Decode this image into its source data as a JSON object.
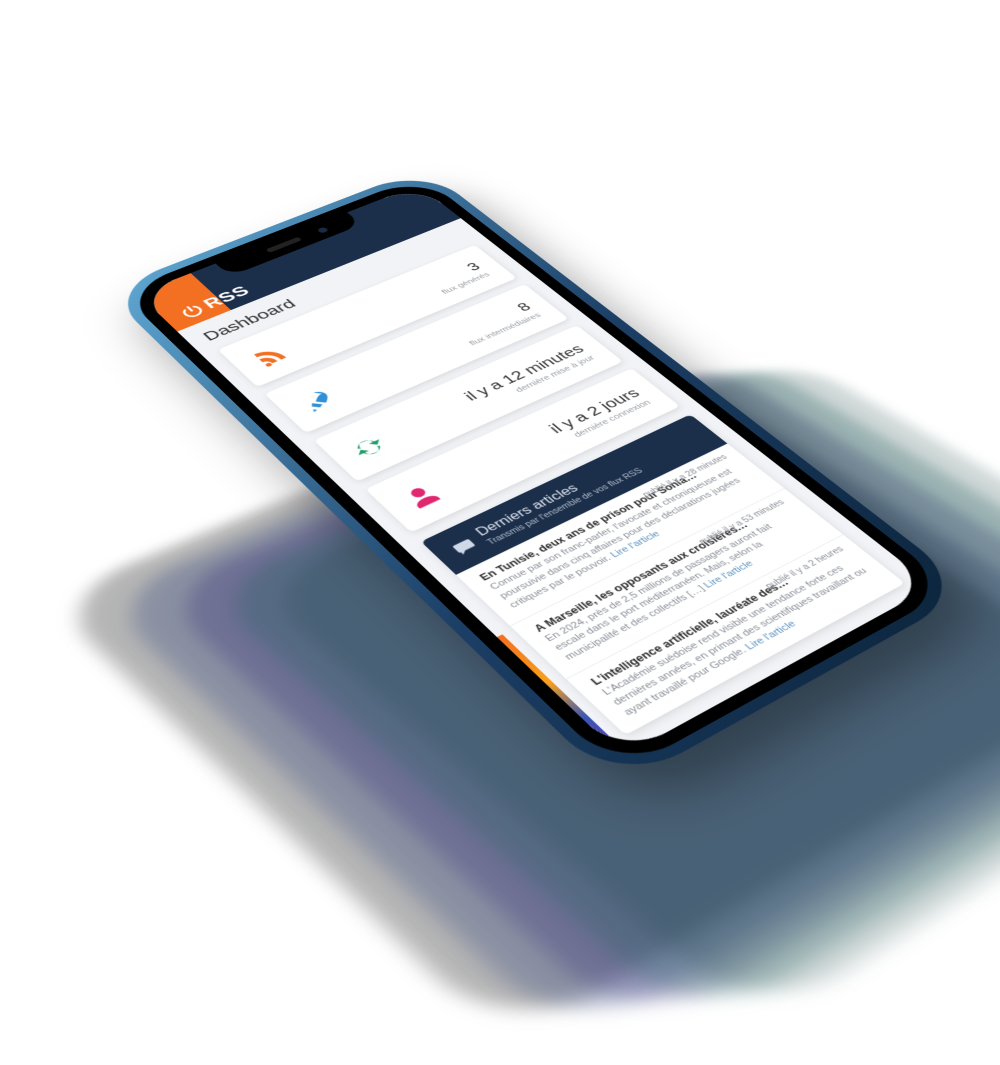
{
  "brand": "RSS",
  "page_title": "Dashboard",
  "stats": [
    {
      "icon": "rss",
      "color": "#f36f21",
      "value": "3",
      "label": "flux générés"
    },
    {
      "icon": "rocket",
      "color": "#2f8fd8",
      "value": "8",
      "label": "flux intermédiaires"
    },
    {
      "icon": "refresh",
      "color": "#1e9e6a",
      "value": "il y a 12 minutes",
      "label": "dernière mise à jour"
    },
    {
      "icon": "user",
      "color": "#e0276f",
      "value": "il y a 2 jours",
      "label": "dernière connexion"
    }
  ],
  "panel": {
    "title": "Derniers articles",
    "subtitle": "Transmis par l'ensemble de vos flux RSS",
    "link_label": "Lire l'article"
  },
  "articles": [
    {
      "title": "En Tunisie, deux ans de prison pour Sonia…",
      "desc": "Connue par son franc-parler, l'avocate et chroniqueuse est poursuivie dans cinq affaires pour des déclarations jugées critiques par le pouvoir.",
      "time": "publié il y a 28 minutes"
    },
    {
      "title": "A Marseille, les opposants aux croisières…",
      "desc": "En 2024, près de 2,5 millions de passagers auront fait escale dans le port méditerranéen. Mais, selon la municipalité et des collectifs […]",
      "time": "publié il y a 53 minutes"
    },
    {
      "title": "L'intelligence artificielle, lauréate des…",
      "desc": "L'Académie suédoise rend visible une tendance forte ces dernières années, en primant des scientifiques travaillant ou ayant travaillé pour Google.",
      "time": "publié il y a 2 heures"
    }
  ]
}
